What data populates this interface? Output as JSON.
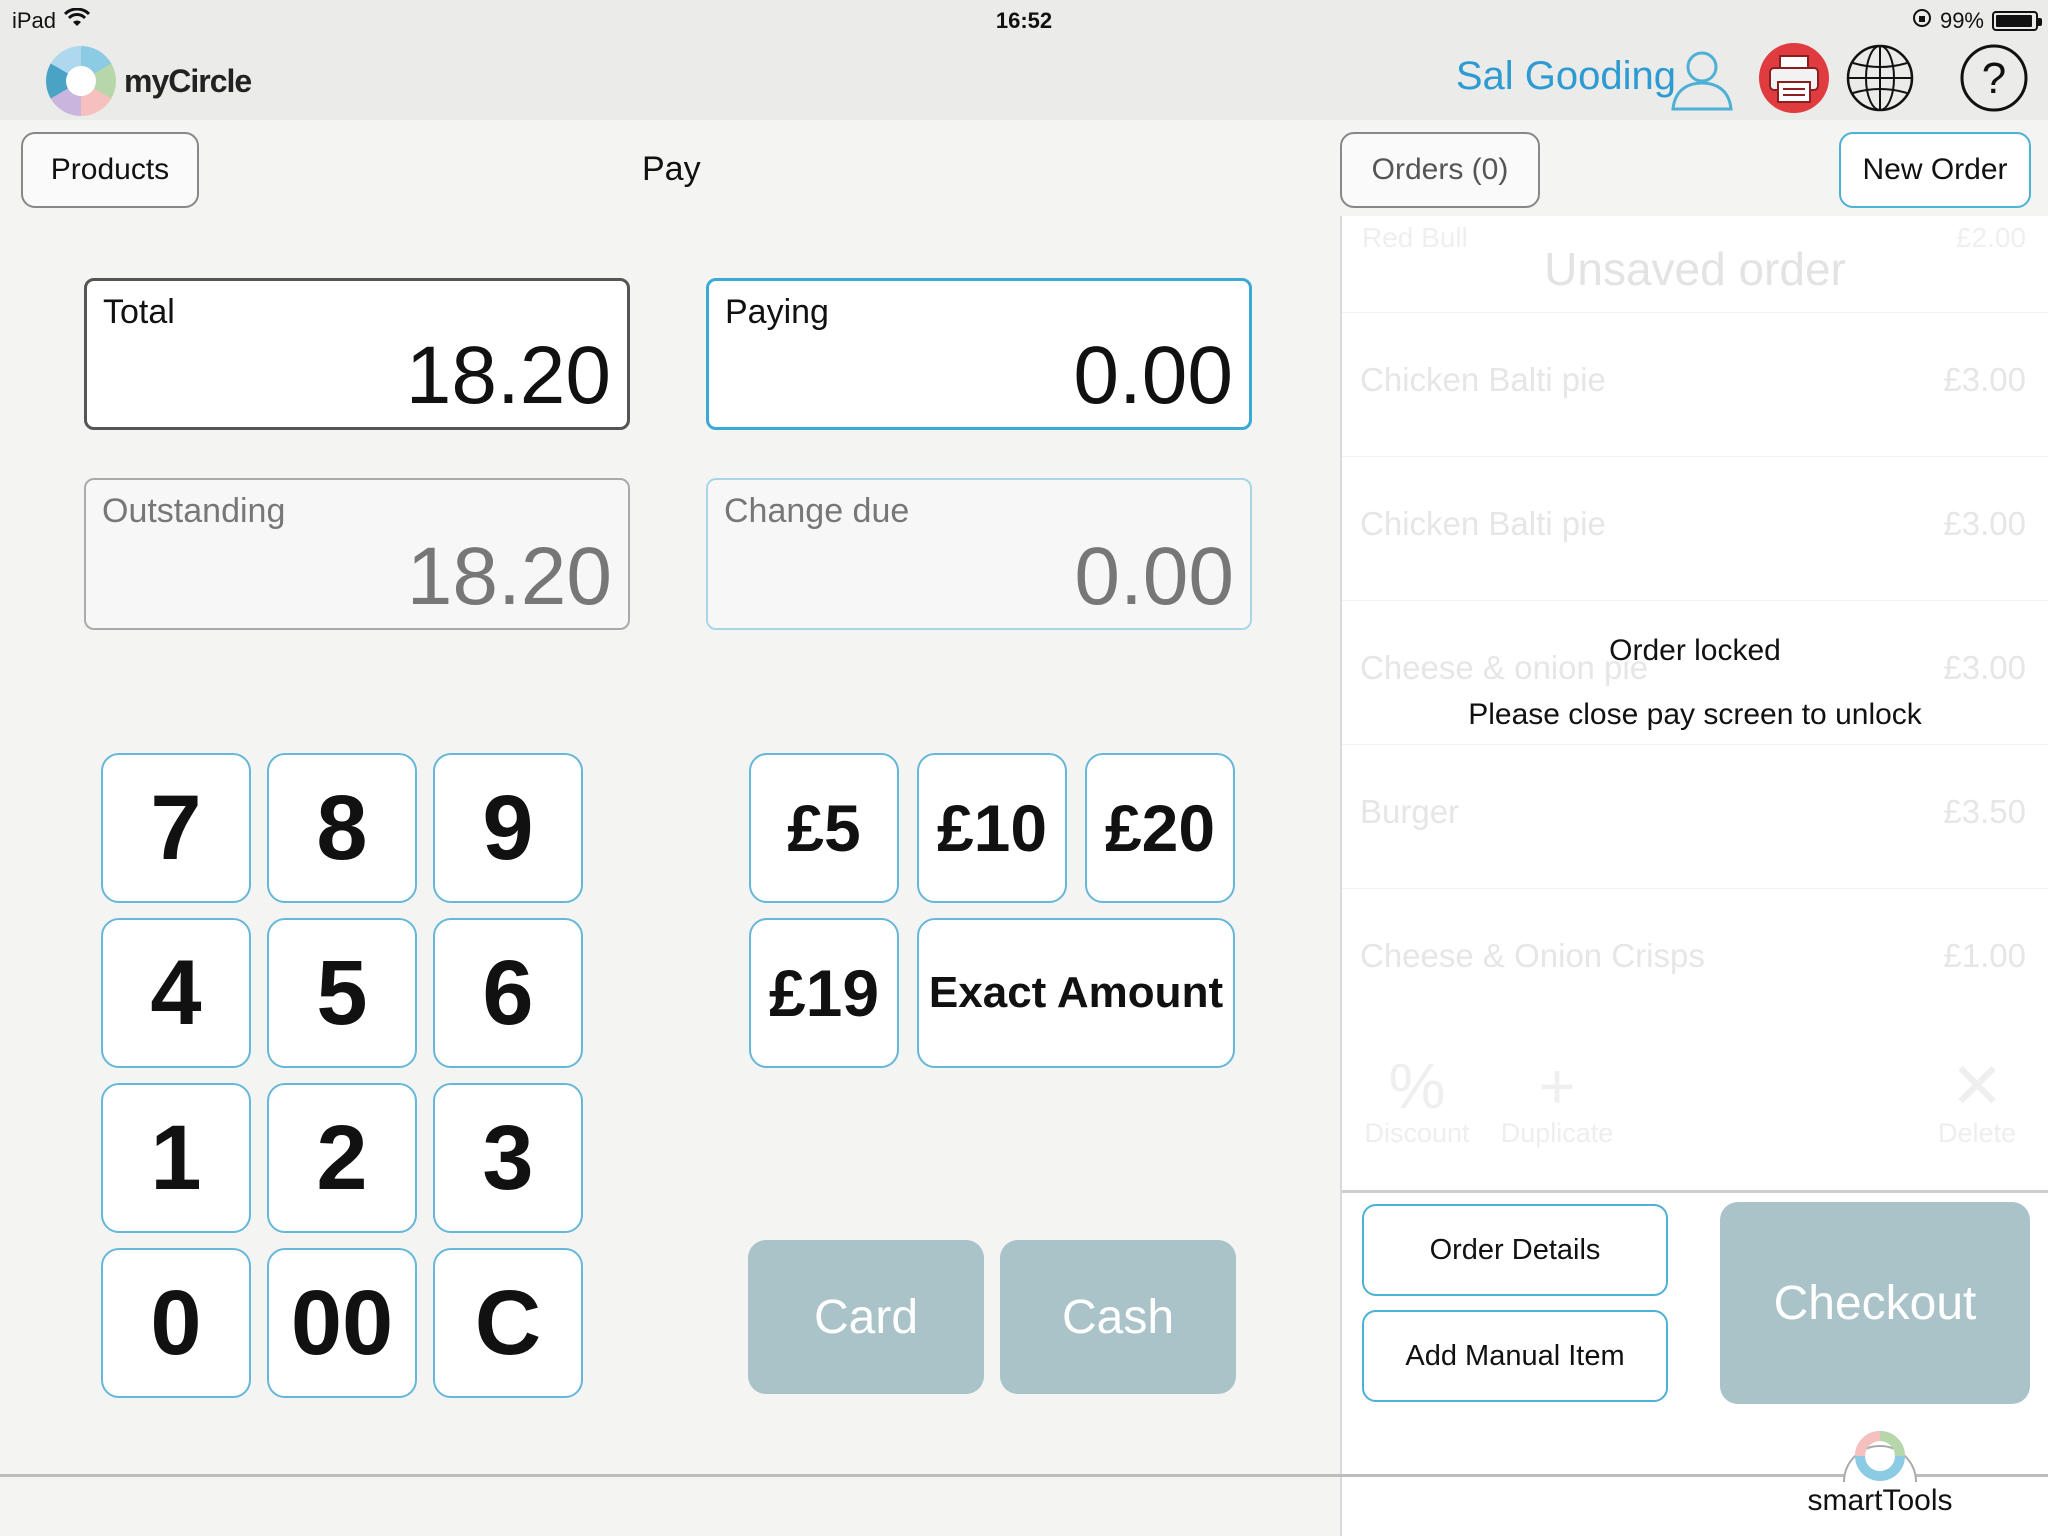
{
  "status_bar": {
    "device": "iPad",
    "time": "16:52",
    "battery": "99%"
  },
  "header": {
    "app_name": "myCircle",
    "user_name": "Sal Gooding",
    "icons": [
      "user-icon",
      "printer-icon",
      "globe-icon",
      "help-icon"
    ]
  },
  "toolbar": {
    "products_label": "Products",
    "page_title": "Pay",
    "orders_label": "Orders (0)",
    "new_order_label": "New Order"
  },
  "pay": {
    "total": {
      "label": "Total",
      "value": "18.20"
    },
    "paying": {
      "label": "Paying",
      "value": "0.00"
    },
    "outstanding": {
      "label": "Outstanding",
      "value": "18.20"
    },
    "change_due": {
      "label": "Change due",
      "value": "0.00"
    }
  },
  "keypad": [
    "7",
    "8",
    "9",
    "4",
    "5",
    "6",
    "1",
    "2",
    "3",
    "0",
    "00",
    "C"
  ],
  "quick_amounts": {
    "q5": "£5",
    "q10": "£10",
    "q20": "£20",
    "q19": "£19",
    "exact": "Exact Amount"
  },
  "payment_methods": {
    "card": "Card",
    "cash": "Cash"
  },
  "order": {
    "title": "Unsaved order",
    "ghost_top_name": "Red Bull",
    "ghost_top_price": "£2.00",
    "items": [
      {
        "name": "Chicken Balti pie",
        "price": "£3.00"
      },
      {
        "name": "Chicken Balti pie",
        "price": "£3.00"
      },
      {
        "name": "Cheese & onion pie",
        "price": "£3.00"
      },
      {
        "name": "Burger",
        "price": "£3.50"
      },
      {
        "name": "Cheese & Onion Crisps",
        "price": "£1.00"
      }
    ],
    "actions": {
      "discount": "Discount",
      "duplicate": "Duplicate",
      "delete": "Delete"
    },
    "lock_title": "Order locked",
    "lock_message": "Please close pay screen to unlock"
  },
  "order_buttons": {
    "details": "Order Details",
    "manual": "Add Manual Item",
    "checkout": "Checkout"
  },
  "footer": {
    "smart_tools": "smartTools"
  },
  "colors": {
    "accent_blue": "#3aa9d6",
    "disabled_button": "#a9c3c8",
    "printer_red": "#e03b3f"
  }
}
